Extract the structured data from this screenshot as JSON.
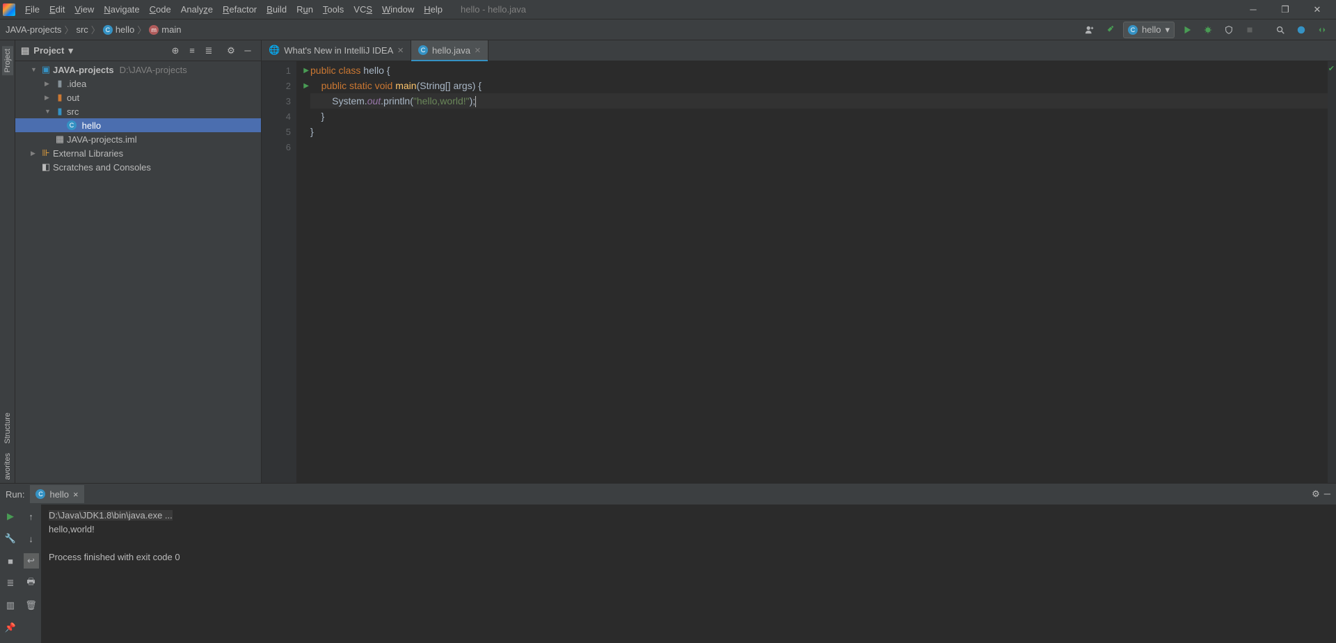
{
  "window": {
    "title": "hello - hello.java"
  },
  "menu": [
    "File",
    "Edit",
    "View",
    "Navigate",
    "Code",
    "Analyze",
    "Refactor",
    "Build",
    "Run",
    "Tools",
    "VCS",
    "Window",
    "Help"
  ],
  "breadcrumb": [
    {
      "label": "JAVA-projects",
      "icon": null
    },
    {
      "label": "src",
      "icon": null
    },
    {
      "label": "hello",
      "icon": "c"
    },
    {
      "label": "main",
      "icon": "m"
    }
  ],
  "runconfig": {
    "label": "hello"
  },
  "projectPanel": {
    "title": "Project"
  },
  "tree": {
    "root": {
      "name": "JAVA-projects",
      "path": "D:\\JAVA-projects"
    },
    "idea": ".idea",
    "out": "out",
    "src": "src",
    "hello": "hello",
    "iml": "JAVA-projects.iml",
    "ext": "External Libraries",
    "scratches": "Scratches and Consoles"
  },
  "tabs": [
    {
      "label": "What's New in IntelliJ IDEA",
      "active": false,
      "icon": "globe"
    },
    {
      "label": "hello.java",
      "active": true,
      "icon": "class"
    }
  ],
  "code": {
    "lines": [
      "1",
      "2",
      "3",
      "4",
      "5",
      "6"
    ],
    "l1": {
      "kw1": "public",
      "kw2": "class",
      "name": "hello",
      "brace": " {"
    },
    "l2": {
      "kw1": "public",
      "kw2": "static",
      "kw3": "void",
      "fn": "main",
      "args": "(String[] args) {"
    },
    "l3": {
      "sys": "System.",
      "out": "out",
      "call": ".println(",
      "str": "\"hello,world!\"",
      "end": ");"
    },
    "l4": "    }",
    "l5": "}"
  },
  "run": {
    "label": "Run:",
    "tab": "hello",
    "exe": "D:\\Java\\JDK1.8\\bin\\java.exe ...",
    "out": "hello,world!",
    "exit": "Process finished with exit code 0"
  },
  "sidebar": {
    "project": "Project",
    "structure": "Structure",
    "favorites": "avorites"
  }
}
